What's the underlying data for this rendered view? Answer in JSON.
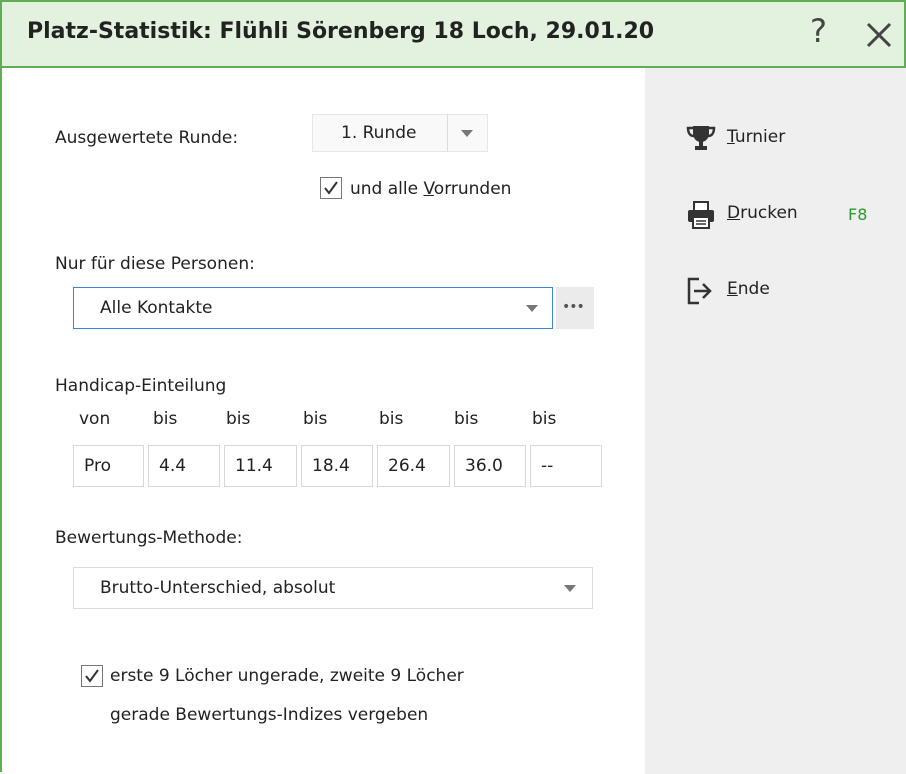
{
  "window": {
    "title": "Platz-Statistik: Flühli Sörenberg 18 Loch, 29.01.20",
    "help_glyph": "?"
  },
  "round": {
    "label": "Ausgewertete Runde:",
    "selected": "1. Runde",
    "include_previous": {
      "pre": "und alle ",
      "mnemonic": "V",
      "post": "orrunden",
      "checked": true
    }
  },
  "persons": {
    "label": "Nur für diese Personen:",
    "selected": "Alle Kontakte",
    "more_glyph": "•••"
  },
  "handicap": {
    "label": "Handicap-Einteilung",
    "headers": [
      "von",
      "bis",
      "bis",
      "bis",
      "bis",
      "bis",
      "bis"
    ],
    "values": [
      "Pro",
      "4.4",
      "11.4",
      "18.4",
      "26.4",
      "36.0",
      "--"
    ]
  },
  "method": {
    "label": "Bewertungs-Methode:",
    "selected": "Brutto-Unterschied, absolut"
  },
  "odd_even": {
    "line1": "erste 9 Löcher ungerade, zweite 9 Löcher",
    "line2": "gerade Bewertungs-Indizes vergeben",
    "checked": true
  },
  "sidebar": {
    "tournament": {
      "mnemonic": "T",
      "rest": "urnier",
      "icon": "trophy-icon"
    },
    "print": {
      "mnemonic": "D",
      "rest": "rucken",
      "hotkey": "F8",
      "icon": "printer-icon"
    },
    "exit": {
      "mnemonic": "E",
      "rest": "nde",
      "icon": "exit-icon"
    }
  },
  "colors": {
    "title_bg": "#e3f2df",
    "border": "#5fae55",
    "panel_bg": "#efefef",
    "focus": "#3c82d6",
    "hotkey": "#2a9a2a"
  }
}
